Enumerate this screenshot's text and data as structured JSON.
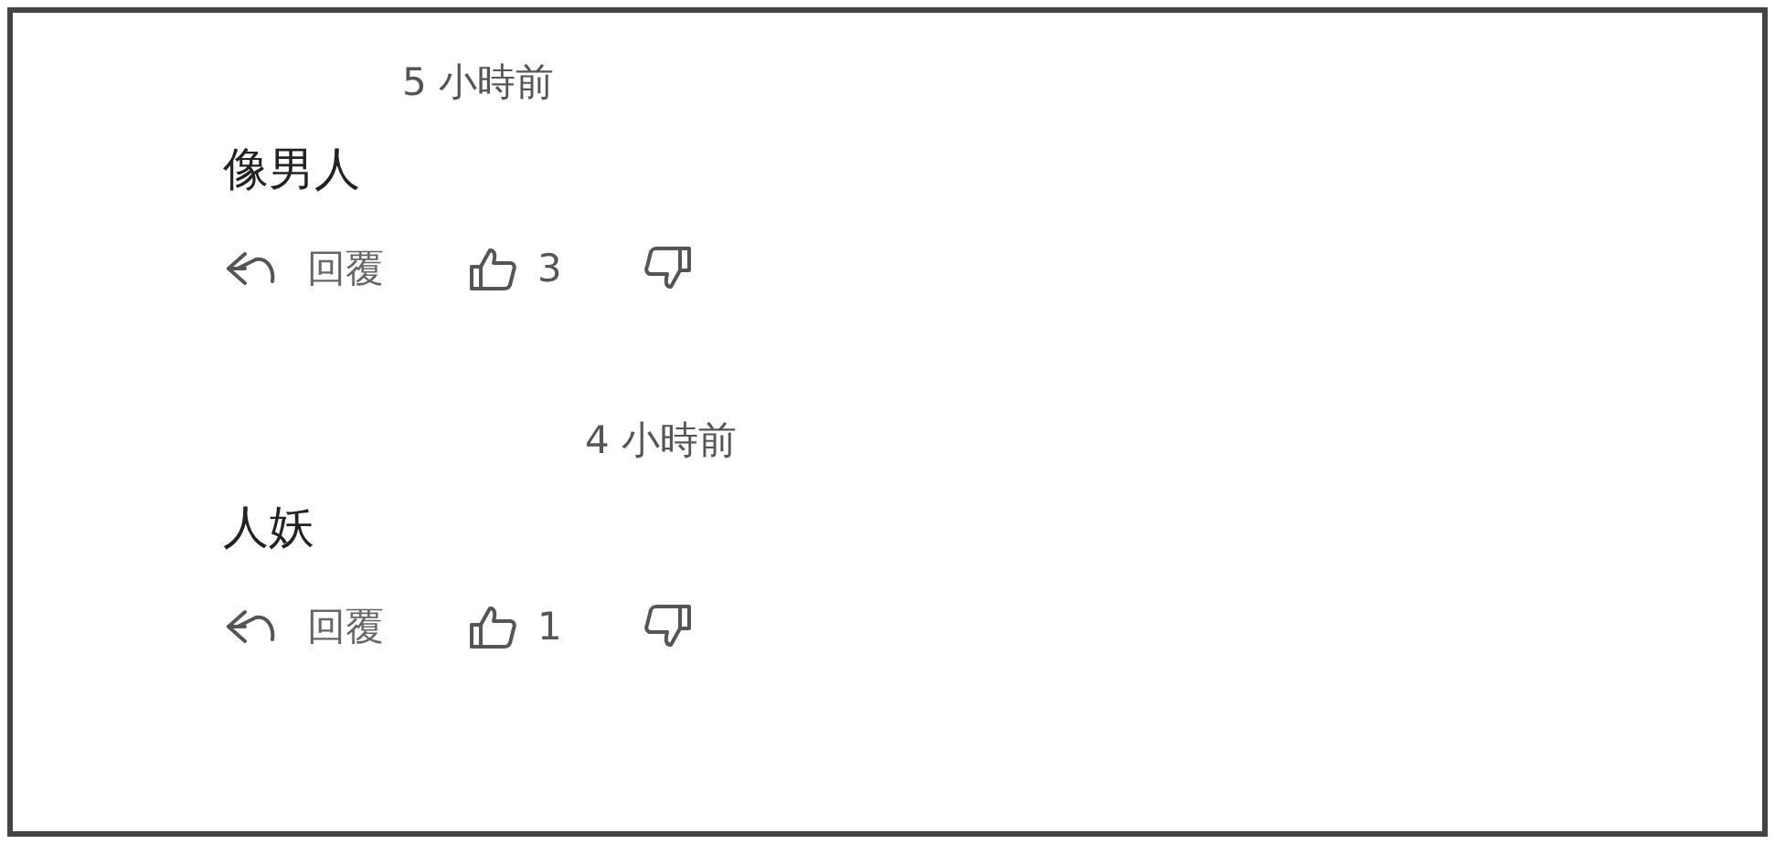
{
  "comments": [
    {
      "time": "5 小時前",
      "text": "像男人",
      "reply": "回覆",
      "likes": "3"
    },
    {
      "time": "4 小時前",
      "text": "人妖",
      "reply": "回覆",
      "likes": "1"
    }
  ]
}
